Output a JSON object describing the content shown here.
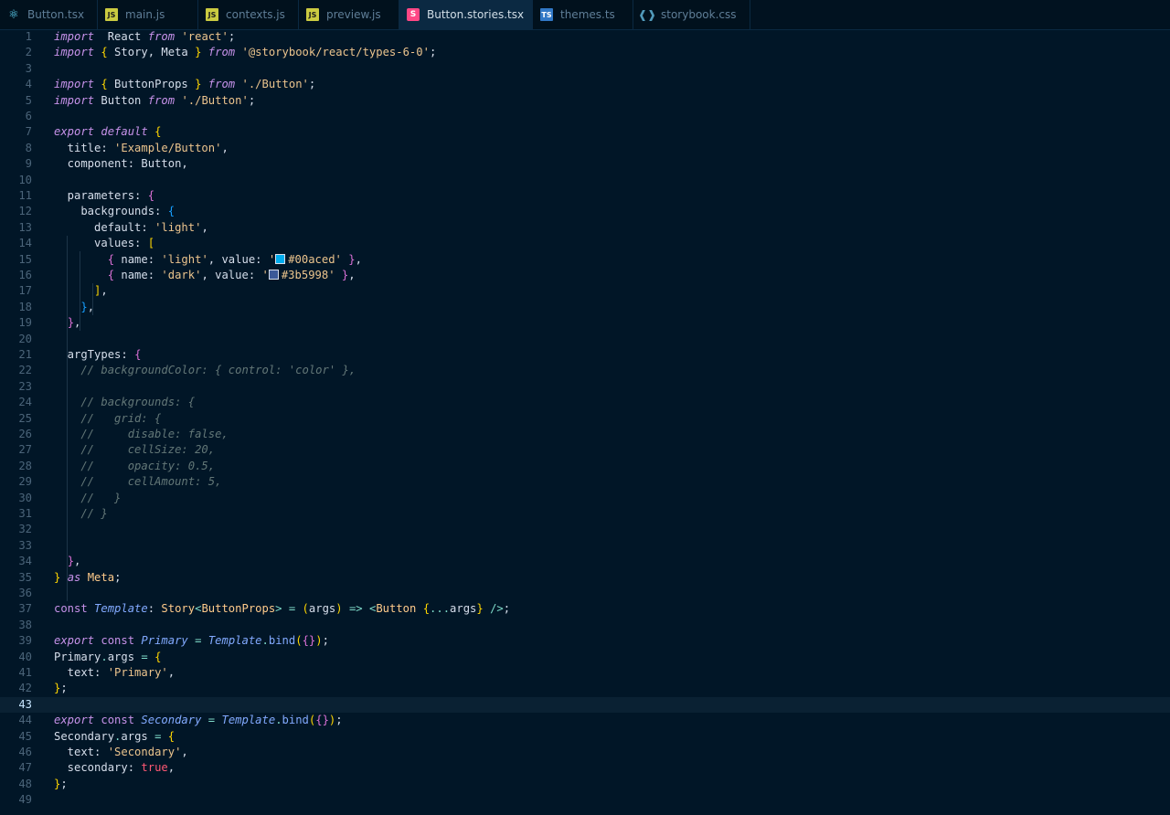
{
  "tabs": [
    {
      "label": "Button.tsx",
      "icon": "react-icon",
      "active": false
    },
    {
      "label": "main.js",
      "icon": "js-icon",
      "active": false
    },
    {
      "label": "contexts.js",
      "icon": "js-icon",
      "active": false
    },
    {
      "label": "preview.js",
      "icon": "js-icon",
      "active": false
    },
    {
      "label": "Button.stories.tsx",
      "icon": "storybook-icon",
      "active": true,
      "close": "×"
    },
    {
      "label": "themes.ts",
      "icon": "typescript-icon",
      "active": false
    },
    {
      "label": "storybook.css",
      "icon": "css-icon",
      "active": false
    }
  ],
  "editor": {
    "current_line": 43,
    "line_numbers": [
      "1",
      "2",
      "3",
      "4",
      "5",
      "6",
      "7",
      "8",
      "9",
      "10",
      "11",
      "12",
      "13",
      "14",
      "15",
      "16",
      "17",
      "18",
      "19",
      "20",
      "21",
      "22",
      "23",
      "24",
      "25",
      "26",
      "27",
      "28",
      "29",
      "30",
      "31",
      "32",
      "33",
      "34",
      "35",
      "36",
      "37",
      "38",
      "39",
      "40",
      "41",
      "42",
      "43",
      "44",
      "45",
      "46",
      "47",
      "48",
      "49"
    ],
    "lines": [
      [
        [
          "kw",
          "import"
        ],
        [
          "",
          "  React "
        ],
        [
          "kw",
          "from"
        ],
        [
          "",
          ""
        ],
        [
          "str",
          "'react'"
        ],
        [
          "",
          ";"
        ]
      ],
      [
        [
          "kw",
          "import"
        ],
        [
          "",
          ""
        ],
        [
          "b1",
          "{"
        ],
        [
          "",
          " Story, Meta "
        ],
        [
          "b1",
          "}"
        ],
        [
          "",
          ""
        ],
        [
          "kw",
          "from"
        ],
        [
          "",
          ""
        ],
        [
          "str",
          "'@storybook/react/types-6-0'"
        ],
        [
          "",
          ";"
        ]
      ],
      [],
      [
        [
          "kw",
          "import"
        ],
        [
          "",
          ""
        ],
        [
          "b1",
          "{"
        ],
        [
          "",
          " ButtonProps "
        ],
        [
          "b1",
          "}"
        ],
        [
          "",
          ""
        ],
        [
          "kw",
          "from"
        ],
        [
          "",
          ""
        ],
        [
          "str",
          "'./Button'"
        ],
        [
          "",
          ";"
        ]
      ],
      [
        [
          "kw",
          "import"
        ],
        [
          "",
          " Button "
        ],
        [
          "kw",
          "from"
        ],
        [
          "",
          ""
        ],
        [
          "str",
          "'./Button'"
        ],
        [
          "",
          ";"
        ]
      ],
      [],
      [
        [
          "kw",
          "export"
        ],
        [
          "",
          ""
        ],
        [
          "kw",
          "default"
        ],
        [
          "",
          ""
        ],
        [
          "b1",
          "{"
        ]
      ],
      [
        [
          "",
          "  title: "
        ],
        [
          "str",
          "'Example/Button'"
        ],
        [
          "",
          ","
        ]
      ],
      [
        [
          "",
          "  component: Button,"
        ]
      ],
      [],
      [
        [
          "",
          "  parameters: "
        ],
        [
          "b2",
          "{"
        ]
      ],
      [
        [
          "",
          "    backgrounds: "
        ],
        [
          "b3",
          "{"
        ]
      ],
      [
        [
          "",
          "      default: "
        ],
        [
          "str",
          "'light'"
        ],
        [
          "",
          ","
        ]
      ],
      [
        [
          "",
          "      values: "
        ],
        [
          "b1",
          "["
        ]
      ],
      [
        [
          "",
          "        "
        ],
        [
          "b2",
          "{"
        ],
        [
          "",
          " name: "
        ],
        [
          "str",
          "'light'"
        ],
        [
          "",
          ", value: "
        ],
        [
          "str",
          "'"
        ],
        [
          "sw",
          "#00aced"
        ],
        [
          "str",
          "#00aced'"
        ],
        [
          "",
          ""
        ],
        [
          "b2",
          "}"
        ],
        [
          "",
          ","
        ]
      ],
      [
        [
          "",
          "        "
        ],
        [
          "b2",
          "{"
        ],
        [
          "",
          " name: "
        ],
        [
          "str",
          "'dark'"
        ],
        [
          "",
          ", value: "
        ],
        [
          "str",
          "'"
        ],
        [
          "sw",
          "#3b5998"
        ],
        [
          "str",
          "#3b5998'"
        ],
        [
          "",
          ""
        ],
        [
          "b2",
          "}"
        ],
        [
          "",
          ","
        ]
      ],
      [
        [
          "",
          "      "
        ],
        [
          "b1",
          "]"
        ],
        [
          "",
          ","
        ]
      ],
      [
        [
          "",
          "    "
        ],
        [
          "b3",
          "}"
        ],
        [
          "",
          ","
        ]
      ],
      [
        [
          "",
          "  "
        ],
        [
          "b2",
          "}"
        ],
        [
          "",
          ","
        ]
      ],
      [],
      [
        [
          "",
          "  argTypes: "
        ],
        [
          "b2",
          "{"
        ]
      ],
      [
        [
          "cm",
          "    // backgroundColor: { control: 'color' },"
        ]
      ],
      [],
      [
        [
          "cm",
          "    // backgrounds: {"
        ]
      ],
      [
        [
          "cm",
          "    //   grid: {"
        ]
      ],
      [
        [
          "cm",
          "    //     disable: false,"
        ]
      ],
      [
        [
          "cm",
          "    //     cellSize: 20,"
        ]
      ],
      [
        [
          "cm",
          "    //     opacity: 0.5,"
        ]
      ],
      [
        [
          "cm",
          "    //     cellAmount: 5,"
        ]
      ],
      [
        [
          "cm",
          "    //   }"
        ]
      ],
      [
        [
          "cm",
          "    // }"
        ]
      ],
      [],
      [],
      [
        [
          "",
          "  "
        ],
        [
          "b2",
          "}"
        ],
        [
          "",
          ","
        ]
      ],
      [
        [
          "b1",
          "}"
        ],
        [
          "",
          ""
        ],
        [
          "kw",
          "as"
        ],
        [
          "",
          ""
        ],
        [
          "ty",
          "Meta"
        ],
        [
          "",
          ";"
        ]
      ],
      [],
      [
        [
          "kwn",
          "const"
        ],
        [
          "",
          ""
        ],
        [
          "fn",
          "Template"
        ],
        [
          "",
          ": "
        ],
        [
          "ty",
          "Story"
        ],
        [
          "op",
          "<"
        ],
        [
          "ty",
          "ButtonProps"
        ],
        [
          "op",
          ">"
        ],
        [
          "",
          ""
        ],
        [
          "op",
          "="
        ],
        [
          "",
          ""
        ],
        [
          "b1",
          "("
        ],
        [
          "",
          "args"
        ],
        [
          "b1",
          ")"
        ],
        [
          "",
          ""
        ],
        [
          "op",
          "=>"
        ],
        [
          "",
          ""
        ],
        [
          "op",
          "<"
        ],
        [
          "ty",
          "Button"
        ],
        [
          "",
          ""
        ],
        [
          "b1",
          "{"
        ],
        [
          "op",
          "..."
        ],
        [
          "",
          "args"
        ],
        [
          "b1",
          "}"
        ],
        [
          "",
          ""
        ],
        [
          "op",
          "/>"
        ],
        [
          "",
          ";"
        ]
      ],
      [],
      [
        [
          "kw",
          "export"
        ],
        [
          "",
          ""
        ],
        [
          "kwn",
          "const"
        ],
        [
          "",
          ""
        ],
        [
          "fn",
          "Primary"
        ],
        [
          "",
          ""
        ],
        [
          "op",
          "="
        ],
        [
          "",
          ""
        ],
        [
          "fn",
          "Template"
        ],
        [
          "op",
          "."
        ],
        [
          "fnn",
          "bind"
        ],
        [
          "b1",
          "("
        ],
        [
          "b2",
          "{}"
        ],
        [
          "b1",
          ")"
        ],
        [
          "",
          ";"
        ]
      ],
      [
        [
          "",
          "Primary"
        ],
        [
          "op",
          "."
        ],
        [
          "",
          "args "
        ],
        [
          "op",
          "="
        ],
        [
          "",
          ""
        ],
        [
          "b1",
          "{"
        ]
      ],
      [
        [
          "",
          "  text: "
        ],
        [
          "str",
          "'Primary'"
        ],
        [
          "",
          ","
        ]
      ],
      [
        [
          "b1",
          "}"
        ],
        [
          "",
          ";"
        ]
      ],
      [],
      [
        [
          "kw",
          "export"
        ],
        [
          "",
          ""
        ],
        [
          "kwn",
          "const"
        ],
        [
          "",
          ""
        ],
        [
          "fn",
          "Secondary"
        ],
        [
          "",
          ""
        ],
        [
          "op",
          "="
        ],
        [
          "",
          ""
        ],
        [
          "fn",
          "Template"
        ],
        [
          "op",
          "."
        ],
        [
          "fnn",
          "bind"
        ],
        [
          "b1",
          "("
        ],
        [
          "b2",
          "{}"
        ],
        [
          "b1",
          ")"
        ],
        [
          "",
          ";"
        ]
      ],
      [
        [
          "",
          "Secondary"
        ],
        [
          "op",
          "."
        ],
        [
          "",
          "args "
        ],
        [
          "op",
          "="
        ],
        [
          "",
          ""
        ],
        [
          "b1",
          "{"
        ]
      ],
      [
        [
          "",
          "  text: "
        ],
        [
          "str",
          "'Secondary'"
        ],
        [
          "",
          ","
        ]
      ],
      [
        [
          "",
          "  secondary: "
        ],
        [
          "bool",
          "true"
        ],
        [
          "",
          ","
        ]
      ],
      [
        [
          "b1",
          "}"
        ],
        [
          "",
          ";"
        ]
      ],
      []
    ]
  }
}
